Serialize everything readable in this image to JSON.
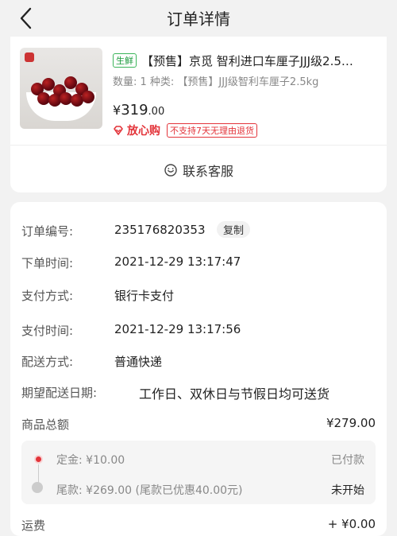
{
  "header": {
    "title": "订单详情"
  },
  "product": {
    "fresh_tag": "生鲜",
    "name": "【预售】京觅 智利进口车厘子JJJ级2.5…",
    "meta": "数量: 1   种类: 【预售】JJJ级智利车厘子2.5kg",
    "price_symbol": "¥",
    "price_int": "319",
    "price_dec": ".00",
    "assurance": "放心购",
    "no_return": "不支持7天无理由退货"
  },
  "service": {
    "label": "联系客服"
  },
  "order_info": {
    "order_no_label": "订单编号:",
    "order_no": "235176820353",
    "copy_label": "复制",
    "order_time_label": "下单时间:",
    "order_time": "2021-12-29  13:17:47",
    "pay_method_label": "支付方式:",
    "pay_method": "银行卡支付",
    "pay_time_label": "支付时间:",
    "pay_time": "2021-12-29  13:17:56",
    "delivery_label": "配送方式:",
    "delivery": "普通快递",
    "expected_label": "期望配送日期:",
    "expected": "工作日、双休日与节假日均可送货"
  },
  "summary": {
    "total_label": "商品总额",
    "total_value": "¥279.00",
    "deposit_label": "定金: ¥10.00",
    "deposit_status": "已付款",
    "balance_label": "尾款: ¥269.00 (尾款已优惠40.00元)",
    "balance_status": "未开始",
    "shipping_label": "运费",
    "shipping_value": "+ ¥0.00"
  },
  "colors": {
    "accent": "#e3343a",
    "fresh": "#1a9a3c"
  }
}
